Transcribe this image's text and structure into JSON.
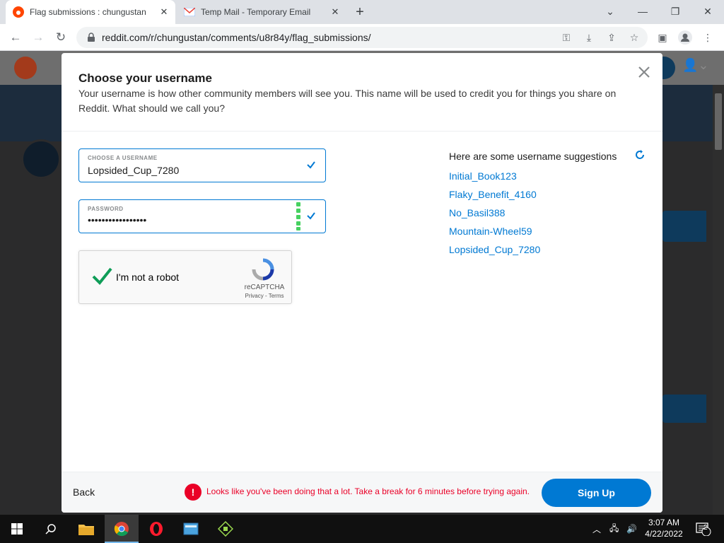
{
  "browser": {
    "tabs": [
      {
        "title": "Flag submissions : chungustan",
        "active": true
      },
      {
        "title": "Temp Mail - Temporary Email",
        "active": false
      }
    ],
    "url": "reddit.com/r/chungustan/comments/u8r84y/flag_submissions/"
  },
  "modal": {
    "title": "Choose your username",
    "description": "Your username is how other community members will see you. This name will be used to credit you for things you share on Reddit. What should we call you?",
    "username_label": "CHOOSE A USERNAME",
    "username_value": "Lopsided_Cup_7280",
    "password_label": "PASSWORD",
    "password_value": "•••••••••••••••••",
    "recaptcha_label": "I'm not a robot",
    "recaptcha_brand": "reCAPTCHA",
    "recaptcha_links": "Privacy - Terms",
    "suggestions_title": "Here are some username suggestions",
    "suggestions": [
      "Initial_Book123",
      "Flaky_Benefit_4160",
      "No_Basil388",
      "Mountain-Wheel59",
      "Lopsided_Cup_7280"
    ],
    "back_label": "Back",
    "error_message": "Looks like you've been doing that a lot. Take a break for 6 minutes before trying again.",
    "signup_label": "Sign Up"
  },
  "taskbar": {
    "time": "3:07 AM",
    "date": "4/22/2022",
    "notification_count": "2"
  },
  "colors": {
    "reddit_blue": "#0079d3",
    "error_red": "#ea0027",
    "check_green": "#0f9d58"
  }
}
